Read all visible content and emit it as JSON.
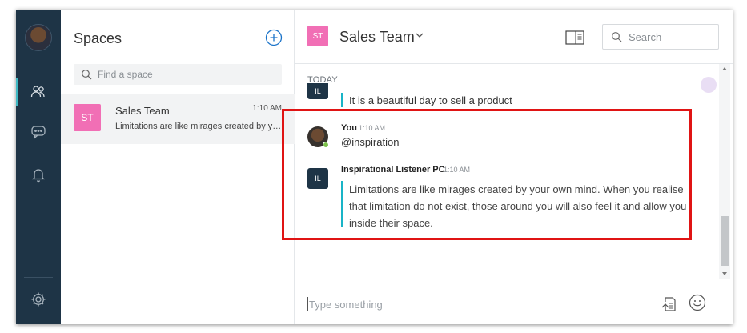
{
  "rail": {
    "items": [
      {
        "name": "spaces-nav",
        "icon": "people-icon",
        "active": true
      },
      {
        "name": "messages-nav",
        "icon": "chat-bubble-icon",
        "active": false
      },
      {
        "name": "notifications-nav",
        "icon": "bell-icon",
        "active": false
      }
    ],
    "settings_icon": "gear-icon",
    "accent": "#3fb9c4"
  },
  "spaces": {
    "title": "Spaces",
    "search_placeholder": "Find a space",
    "items": [
      {
        "initials": "ST",
        "name": "Sales Team",
        "time": "1:10 AM",
        "preview": "Limitations are like mirages created by your own mind. When you realise that limitation do not exist, those around you will also feel it and allow you inside their space."
      }
    ]
  },
  "chat": {
    "initials": "ST",
    "title": "Sales Team",
    "search_placeholder": "Search",
    "date_divider": "TODAY",
    "messages": [
      {
        "avatar_initials": "IL",
        "text": "It is a beautiful day to sell a product"
      },
      {
        "sender": "You",
        "time": "1:10 AM",
        "text": "@inspiration"
      },
      {
        "avatar_initials": "IL",
        "sender": "Inspirational Listener PC",
        "time": "1:10 AM",
        "text": "Limitations are like mirages created by your own mind. When you realise that limitation do not exist, those around you will also feel it and allow you inside their space."
      }
    ],
    "composer_placeholder": "Type something"
  },
  "colors": {
    "rail_bg": "#1e3446",
    "space_badge": "#f16fb5",
    "quote_bar": "#19b4c7",
    "highlight_box": "#e01414",
    "online": "#7cc04b"
  }
}
